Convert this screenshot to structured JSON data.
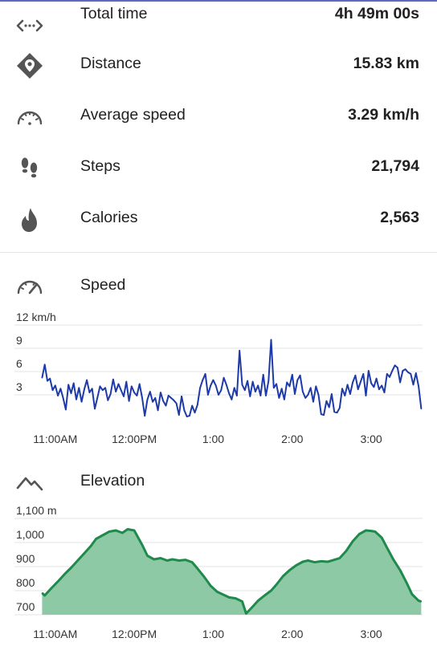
{
  "stats": [
    {
      "icon": "route-arrows-icon",
      "label": "Total time",
      "value": "4h 49m 00s"
    },
    {
      "icon": "location-pin-icon",
      "label": "Distance",
      "value": "15.83 km"
    },
    {
      "icon": "speedometer-icon",
      "label": "Average speed",
      "value": "3.29 km/h"
    },
    {
      "icon": "footsteps-icon",
      "label": "Steps",
      "value": "21,794"
    },
    {
      "icon": "flame-icon",
      "label": "Calories",
      "value": "2,563"
    }
  ],
  "speed_section": {
    "title": "Speed",
    "icon": "speedometer-icon"
  },
  "elevation_section": {
    "title": "Elevation",
    "icon": "mountain-icon"
  },
  "colors": {
    "speed_line": "#1e3aa8",
    "elevation_line": "#1f8a4c",
    "elevation_fill": "#8ec9a6",
    "grid": "#e3e3e3",
    "icon": "#555555"
  },
  "chart_data": [
    {
      "type": "line",
      "title": "Speed",
      "xlabel": "",
      "ylabel": "",
      "x_tick_labels": [
        "11:00AM",
        "12:00PM",
        "1:00",
        "2:00",
        "3:00"
      ],
      "x_ticks": [
        "11:00",
        "12:00",
        "13:00",
        "14:00",
        "15:00"
      ],
      "y_tick_labels": [
        "12 km/h",
        "9",
        "6",
        "3"
      ],
      "y_ticks": [
        12,
        9,
        6,
        3
      ],
      "ylim": [
        0,
        12
      ],
      "xlim": [
        "10:29",
        "15:39"
      ],
      "grid": true,
      "series": [
        {
          "x": [
            "10:50",
            "10:52",
            "10:54",
            "10:56",
            "10:58",
            "11:00",
            "11:02",
            "11:04",
            "11:06",
            "11:08",
            "11:10",
            "11:12",
            "11:14",
            "11:16",
            "11:18",
            "11:20",
            "11:22",
            "11:24",
            "11:26",
            "11:28",
            "11:30",
            "11:32",
            "11:34",
            "11:36",
            "11:38",
            "11:40",
            "11:42",
            "11:44",
            "11:46",
            "11:48",
            "11:50",
            "11:52",
            "11:54",
            "11:56",
            "11:58",
            "12:00",
            "12:02",
            "12:04",
            "12:06",
            "12:08",
            "12:10",
            "12:12",
            "12:14",
            "12:16",
            "12:18",
            "12:20",
            "12:22",
            "12:24",
            "12:26",
            "12:28",
            "12:30",
            "12:32",
            "12:34",
            "12:36",
            "12:38",
            "12:40",
            "12:42",
            "12:44",
            "12:46",
            "12:48",
            "12:50",
            "12:52",
            "12:54",
            "12:56",
            "12:58",
            "13:00",
            "13:02",
            "13:04",
            "13:06",
            "13:08",
            "13:10",
            "13:12",
            "13:14",
            "13:16",
            "13:18",
            "13:20",
            "13:22",
            "13:24",
            "13:26",
            "13:28",
            "13:30",
            "13:32",
            "13:34",
            "13:36",
            "13:38",
            "13:40",
            "13:42",
            "13:44",
            "13:46",
            "13:48",
            "13:50",
            "13:52",
            "13:54",
            "13:56",
            "13:58",
            "14:00",
            "14:02",
            "14:04",
            "14:06",
            "14:08",
            "14:10",
            "14:12",
            "14:14",
            "14:16",
            "14:18",
            "14:20",
            "14:22",
            "14:24",
            "14:26",
            "14:28",
            "14:30",
            "14:32",
            "14:34",
            "14:36",
            "14:38",
            "14:40",
            "14:42",
            "14:44",
            "14:46",
            "14:48",
            "14:50",
            "14:52",
            "14:54",
            "14:56",
            "14:58",
            "15:00",
            "15:02",
            "15:04",
            "15:06",
            "15:08",
            "15:10",
            "15:12",
            "15:14",
            "15:16",
            "15:18",
            "15:20",
            "15:22",
            "15:24",
            "15:26",
            "15:28",
            "15:30",
            "15:32",
            "15:34",
            "15:36",
            "15:38"
          ],
          "y": [
            5.2,
            6.9,
            4.8,
            5.1,
            3.6,
            4.2,
            2.9,
            3.8,
            2.6,
            1.1,
            4.3,
            3.2,
            4.5,
            2.4,
            3.9,
            2.1,
            3.7,
            4.9,
            3.3,
            3.8,
            1.2,
            2.6,
            4.1,
            3.6,
            3.9,
            2.3,
            3.1,
            5.0,
            3.4,
            4.4,
            3.6,
            2.8,
            4.7,
            2.2,
            4.1,
            3.3,
            2.9,
            4.4,
            2.6,
            0.3,
            2.4,
            3.4,
            2.1,
            2.6,
            1.0,
            3.3,
            2.2,
            1.6,
            2.9,
            2.6,
            2.3,
            1.9,
            0.4,
            2.8,
            1.0,
            0.2,
            0.3,
            1.6,
            0.7,
            1.7,
            3.9,
            4.9,
            5.7,
            3.0,
            4.2,
            4.9,
            4.2,
            3.0,
            3.6,
            5.2,
            4.3,
            3.2,
            2.4,
            3.9,
            2.9,
            8.7,
            4.3,
            3.6,
            4.8,
            2.8,
            4.7,
            3.4,
            4.2,
            2.9,
            5.6,
            2.9,
            4.8,
            10.1,
            3.9,
            4.4,
            2.6,
            3.8,
            2.4,
            4.6,
            4.1,
            5.6,
            3.1,
            4.9,
            5.5,
            3.4,
            2.6,
            3.0,
            3.9,
            2.1,
            4.1,
            3.0,
            0.5,
            0.4,
            2.2,
            1.4,
            3.1,
            0.8,
            0.7,
            1.3,
            3.8,
            2.9,
            4.3,
            3.1,
            4.6,
            5.5,
            3.7,
            4.7,
            5.7,
            2.9,
            6.1,
            4.5,
            4.0,
            5.1,
            3.7,
            4.2,
            3.3,
            5.7,
            5.3,
            6.1,
            6.8,
            6.5,
            4.6,
            6.1,
            6.3,
            5.9,
            5.7,
            4.3,
            5.8,
            4.1,
            1.2
          ],
          "step": "2 min"
        }
      ]
    },
    {
      "type": "area",
      "title": "Elevation",
      "xlabel": "",
      "ylabel": "",
      "x_tick_labels": [
        "11:00AM",
        "12:00PM",
        "1:00",
        "2:00",
        "3:00"
      ],
      "x_ticks": [
        "11:00",
        "12:00",
        "13:00",
        "14:00",
        "15:00"
      ],
      "y_tick_labels": [
        "1,100 m",
        "1,000",
        "900",
        "800",
        "700"
      ],
      "y_ticks": [
        1100,
        1000,
        900,
        800,
        700
      ],
      "ylim": [
        700,
        1100
      ],
      "xlim": [
        "10:29",
        "15:39"
      ],
      "grid": true,
      "series": [
        {
          "x": [
            "10:50",
            "10:52",
            "10:57",
            "11:02",
            "11:07",
            "11:12",
            "11:17",
            "11:22",
            "11:27",
            "11:31",
            "11:36",
            "11:41",
            "11:46",
            "11:51",
            "11:55",
            "12:00",
            "12:03",
            "12:06",
            "12:10",
            "12:15",
            "12:20",
            "12:25",
            "12:29",
            "12:34",
            "12:39",
            "12:44",
            "12:48",
            "12:53",
            "12:58",
            "13:03",
            "13:07",
            "13:12",
            "13:17",
            "13:22",
            "13:25",
            "13:29",
            "13:34",
            "13:39",
            "13:44",
            "13:48",
            "13:53",
            "13:58",
            "14:03",
            "14:08",
            "14:12",
            "14:17",
            "14:22",
            "14:27",
            "14:32",
            "14:36",
            "14:41",
            "14:46",
            "14:51",
            "14:56",
            "15:00",
            "15:03",
            "15:08",
            "15:12",
            "15:17",
            "15:22",
            "15:27",
            "15:31",
            "15:36",
            "15:38"
          ],
          "y": [
            790,
            780,
            810,
            838,
            868,
            895,
            925,
            955,
            985,
            1015,
            1030,
            1045,
            1050,
            1040,
            1055,
            1050,
            1020,
            990,
            945,
            930,
            935,
            925,
            930,
            925,
            928,
            918,
            892,
            858,
            820,
            795,
            785,
            772,
            768,
            755,
            705,
            728,
            758,
            780,
            800,
            825,
            860,
            885,
            905,
            920,
            925,
            918,
            922,
            920,
            928,
            935,
            965,
            1005,
            1035,
            1050,
            1048,
            1045,
            1020,
            978,
            928,
            885,
            832,
            785,
            758,
            755
          ]
        }
      ]
    }
  ]
}
